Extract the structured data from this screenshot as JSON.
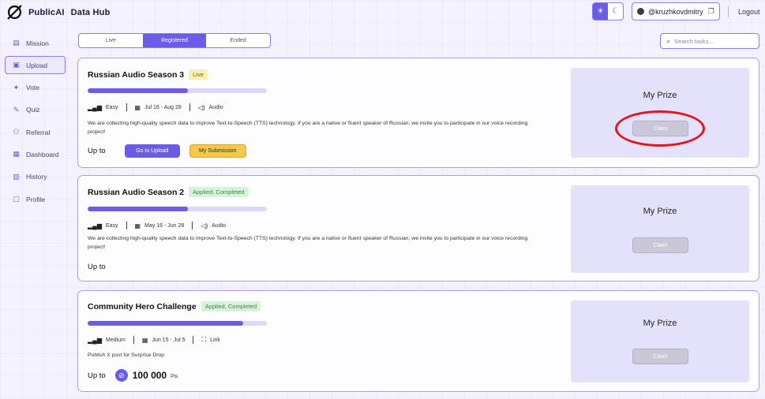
{
  "header": {
    "brand": "PublicAI",
    "product": "Data Hub",
    "theme_light_icon": "sun-icon",
    "theme_dark_icon": "moon-icon",
    "username": "@kruzhkovdmitry",
    "logout_label": "Logout"
  },
  "sidebar": {
    "items": [
      {
        "label": "Mission",
        "icon": "clipboard-icon",
        "glyph": "▤"
      },
      {
        "label": "Upload",
        "icon": "upload-icon",
        "glyph": "▣"
      },
      {
        "label": "Vote",
        "icon": "vote-icon",
        "glyph": "✦"
      },
      {
        "label": "Quiz",
        "icon": "quiz-icon",
        "glyph": "✎"
      },
      {
        "label": "Referral",
        "icon": "referral-icon",
        "glyph": "⚇"
      },
      {
        "label": "Dashboard",
        "icon": "dashboard-icon",
        "glyph": "▦"
      },
      {
        "label": "History",
        "icon": "history-icon",
        "glyph": "▥"
      },
      {
        "label": "Profile",
        "icon": "profile-icon",
        "glyph": "▢"
      }
    ],
    "active": "Upload"
  },
  "tabs": [
    {
      "label": "Live"
    },
    {
      "label": "Registered"
    },
    {
      "label": "Ended"
    }
  ],
  "active_tab": "Registered",
  "search": {
    "placeholder": "Search tasks..."
  },
  "tasks": [
    {
      "title": "Russian Audio Season 3",
      "status": "Live",
      "progress": 0.56,
      "difficulty": "Easy",
      "dates": "Jul 16 - Aug 28",
      "type": "Audio",
      "description": "We are collecting high-quality speech data to improve Text-to-Speech (TTS) technology. If you are a native or fluent speaker of Russian, we invite you to participate in our voice recording project!",
      "upto_label": "Up to",
      "upload_label": "Go to Upload",
      "submission_label": "My Submission",
      "prize_title": "My Prize",
      "claim_label": "Claim"
    },
    {
      "title": "Russian Audio Season 2",
      "status": "Applied, Completed",
      "progress": 0.56,
      "difficulty": "Easy",
      "dates": "May 16 - Jun 28",
      "type": "Audio",
      "description": "We are collecting high-quality speech data to improve Text-to-Speech (TTS) technology. If you are a native or fluent speaker of Russian, we invite you to participate in our voice recording project!",
      "upto_label": "Up to",
      "prize_title": "My Prize",
      "claim_label": "Claim"
    },
    {
      "title": "Community Hero Challenge",
      "status": "Applied, Completed",
      "progress": 0.87,
      "difficulty": "Medium",
      "dates": "Jun 15 - Jul 5",
      "type": "Link",
      "description": "Publish X post for Surprise Drop",
      "upto_label": "Up to",
      "points": "100 000",
      "points_unit": "Pts",
      "prize_title": "My Prize",
      "claim_label": "Claim"
    }
  ],
  "colors": {
    "accent": "#6b5ce7",
    "border": "#a89ff2",
    "highlight_ring": "#e0151d"
  }
}
